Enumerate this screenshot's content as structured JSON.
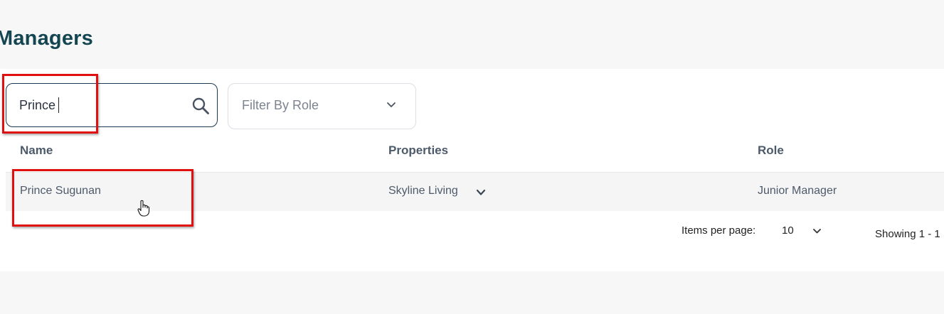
{
  "page": {
    "title": "Managers"
  },
  "search": {
    "value": "Prince",
    "icon": "search-icon"
  },
  "role_filter": {
    "placeholder": "Filter By Role",
    "icon": "chevron-down-icon"
  },
  "table": {
    "columns": [
      "Name",
      "Properties",
      "Role"
    ],
    "rows": [
      {
        "name": "Prince Sugunan",
        "properties": "Skyline Living",
        "role": "Junior Manager"
      }
    ]
  },
  "pagination": {
    "items_per_page_label": "Items per page:",
    "items_per_page_value": "10",
    "showing_text": "Showing 1 - 1"
  },
  "colors": {
    "title": "#144652",
    "highlight": "#e01010",
    "search_border": "#1a3a55"
  }
}
